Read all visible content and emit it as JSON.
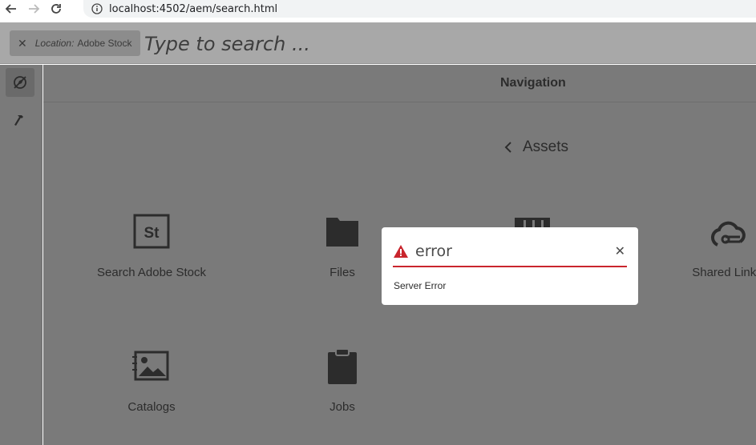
{
  "browser": {
    "url": "localhost:4502/aem/search.html"
  },
  "search": {
    "tag_key": "Location:",
    "tag_value": "Adobe Stock",
    "placeholder": "Type to search ..."
  },
  "navigation": {
    "title": "Navigation",
    "back_label": "Assets",
    "tiles": [
      {
        "label": "Search Adobe Stock",
        "icon": "adobe-stock-icon"
      },
      {
        "label": "Files",
        "icon": "folder-icon"
      },
      {
        "label": "Shared Links",
        "icon": "cloud-link-icon"
      },
      {
        "label": "Catalogs",
        "icon": "catalog-icon"
      },
      {
        "label": "Jobs",
        "icon": "clipboard-icon"
      }
    ]
  },
  "dialog": {
    "title": "error",
    "message": "Server Error",
    "accent_color": "#c9252d"
  }
}
